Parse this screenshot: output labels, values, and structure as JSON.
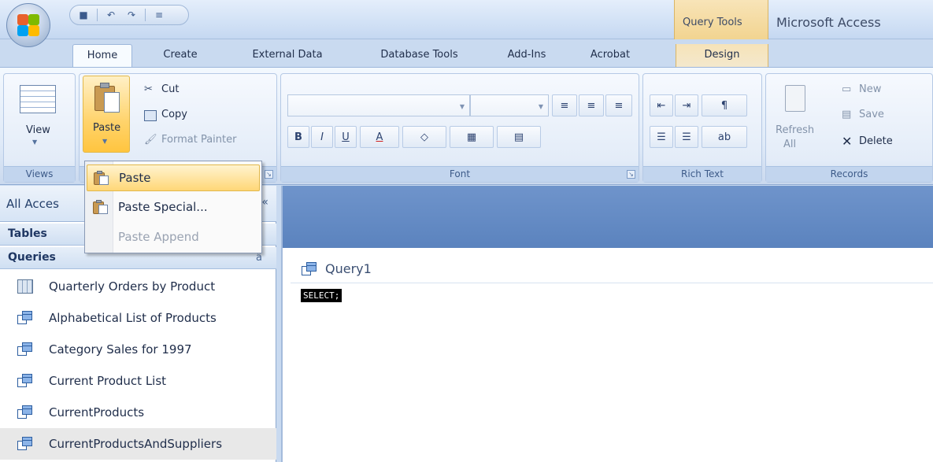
{
  "window": {
    "context_tab_group": "Query Tools",
    "app_title": "Microsoft Access"
  },
  "quick_access": {
    "icons": [
      "save-icon",
      "undo-icon",
      "redo-icon",
      "customize-icon"
    ],
    "glyphs": {
      "save": "■",
      "undo": "↶",
      "redo": "↷",
      "customize": "≡"
    }
  },
  "tabs": [
    {
      "label": "Home",
      "active": true
    },
    {
      "label": "Create"
    },
    {
      "label": "External Data"
    },
    {
      "label": "Database Tools"
    },
    {
      "label": "Add-Ins"
    },
    {
      "label": "Acrobat"
    },
    {
      "label": "Design",
      "context": true
    }
  ],
  "ribbon": {
    "views": {
      "view_label": "View",
      "group_label": "Views"
    },
    "clipboard": {
      "paste_label": "Paste",
      "cut_label": "Cut",
      "copy_label": "Copy",
      "format_painter_label": "Format Painter"
    },
    "font": {
      "group_label": "Font",
      "bold": "B",
      "italic": "I",
      "underline": "U",
      "font_color": "A"
    },
    "rich_text": {
      "group_label": "Rich Text"
    },
    "records": {
      "refresh_label": "Refresh",
      "refresh_sub": "All",
      "new_label": "New",
      "save_label": "Save",
      "delete_label": "Delete",
      "group_label": "Records"
    }
  },
  "paste_menu": {
    "items": [
      {
        "label": "Paste",
        "state": "highlighted"
      },
      {
        "label": "Paste Special...",
        "state": "enabled"
      },
      {
        "label": "Paste Append",
        "state": "disabled"
      }
    ]
  },
  "nav_pane": {
    "header": "All Acces",
    "shutter": "«",
    "sections": [
      {
        "label": "Tables"
      },
      {
        "label": "Queries",
        "chevron": "â"
      }
    ],
    "items": [
      {
        "label": "Quarterly Orders by Product",
        "icon": "crosstab-query-icon"
      },
      {
        "label": "Alphabetical List of Products",
        "icon": "select-query-icon"
      },
      {
        "label": "Category Sales for 1997",
        "icon": "select-query-icon"
      },
      {
        "label": "Current Product List",
        "icon": "select-query-icon"
      },
      {
        "label": "CurrentProducts",
        "icon": "select-query-icon"
      },
      {
        "label": "CurrentProductsAndSuppliers",
        "icon": "select-query-icon",
        "selected": true
      }
    ]
  },
  "document": {
    "tab_label": "Query1",
    "sql_text": "SELECT;"
  },
  "colors": {
    "ribbon_blue": "#dfeaf8",
    "context_orange": "#f2d490",
    "menu_highlight": "#ffd777",
    "main_header": "#5b83be"
  }
}
